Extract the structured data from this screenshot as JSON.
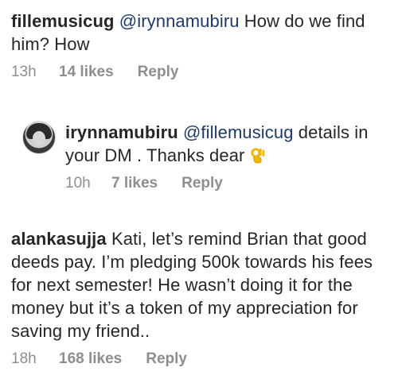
{
  "comments": [
    {
      "username": "fillemusicug",
      "mention": "@irynnamubiru",
      "text": " How do we find him?  How",
      "time": "13h",
      "likes": "14 likes",
      "reply": "Reply"
    },
    {
      "username": "irynnamubiru",
      "mention": "@fillemusicug",
      "text": " details in your  DM . Thanks dear ",
      "emoji": "ok-hand-icon",
      "time": "10h",
      "likes": "7 likes",
      "reply": "Reply"
    },
    {
      "username": "alankasujja",
      "text": " Kati, let’s remind Brian that good deeds pay. I’m pledging 500k towards his fees for next semester!  He wasn’t doing it for the money but it’s a token of my appreciation for saving my friend..",
      "time": "18h",
      "likes": "168 likes",
      "reply": "Reply"
    }
  ],
  "colors": {
    "text": "#262626",
    "meta": "#8e8e8e",
    "mention": "#1f3a68",
    "emoji": "#f4b400"
  }
}
